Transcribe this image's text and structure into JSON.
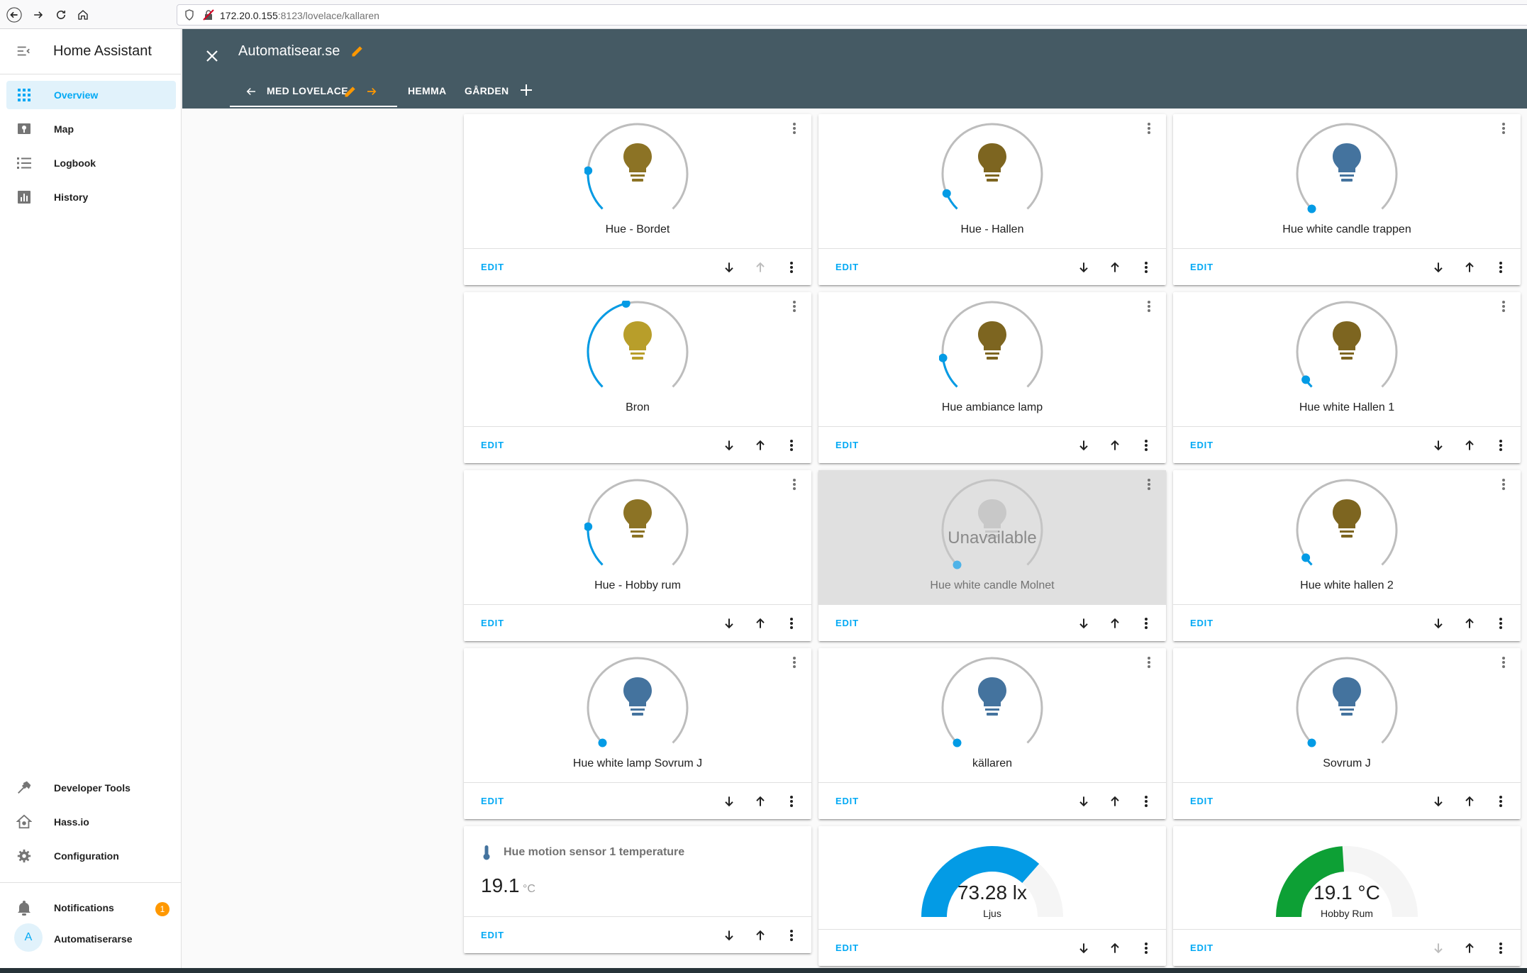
{
  "browser": {
    "url_host": "172.20.0.155",
    "url_rest": ":8123/lovelace/kallaren"
  },
  "sidebar": {
    "title": "Home Assistant",
    "items": [
      {
        "label": "Overview",
        "icon": "grid-icon",
        "active": true
      },
      {
        "label": "Map",
        "icon": "map-icon"
      },
      {
        "label": "Logbook",
        "icon": "list-icon"
      },
      {
        "label": "History",
        "icon": "chart-icon"
      }
    ],
    "bottom_items": [
      {
        "label": "Developer Tools",
        "icon": "hammer-icon"
      },
      {
        "label": "Hass.io",
        "icon": "hassio-icon"
      },
      {
        "label": "Configuration",
        "icon": "gear-icon"
      }
    ],
    "notifications": {
      "label": "Notifications",
      "count": "1"
    },
    "user": {
      "initial": "A",
      "name": "Automatiserarse"
    }
  },
  "header": {
    "title": "Automatisear.se",
    "tabs": [
      {
        "label": "MED LOVELACE",
        "active": true
      },
      {
        "label": "HEMMA"
      },
      {
        "label": "GÅRDEN"
      }
    ]
  },
  "card_actions": {
    "edit_label": "EDIT"
  },
  "lights": [
    {
      "name": "Hue - Bordet",
      "brightness": 0.18,
      "bulb_color": "#8c7325",
      "up_disabled": true
    },
    {
      "name": "Hue - Hallen",
      "brightness": 0.08,
      "bulb_color": "#7d6520"
    },
    {
      "name": "Hue white candle trappen",
      "brightness": 0.0,
      "bulb_color": "#44739e"
    },
    {
      "name": "Bron",
      "brightness": 0.45,
      "bulb_color": "#b89e2a"
    },
    {
      "name": "Hue ambiance lamp",
      "brightness": 0.14,
      "bulb_color": "#7d6520"
    },
    {
      "name": "Hue white Hallen 1",
      "brightness": 0.04,
      "bulb_color": "#7d6520"
    },
    {
      "name": "Hue - Hobby rum",
      "brightness": 0.18,
      "bulb_color": "#8c7325"
    },
    {
      "name": "Hue white candle Molnet",
      "brightness": 0.0,
      "bulb_color": "#c8c8c8",
      "unavailable": true,
      "unavailable_label": "Unavailable"
    },
    {
      "name": "Hue white hallen 2",
      "brightness": 0.04,
      "bulb_color": "#7d6520"
    },
    {
      "name": "Hue white lamp Sovrum J",
      "brightness": 0.0,
      "bulb_color": "#44739e"
    },
    {
      "name": "källaren",
      "brightness": 0.0,
      "bulb_color": "#44739e"
    },
    {
      "name": "Sovrum J",
      "brightness": 0.0,
      "bulb_color": "#44739e"
    }
  ],
  "sensor": {
    "title": "Hue motion sensor 1 temperature",
    "value": "19.1",
    "unit": "°C"
  },
  "gauges": [
    {
      "value_text": "73.28 lx",
      "name": "Ljus",
      "fraction": 0.73,
      "color": "#039be5"
    },
    {
      "value_text": "19.1 °C",
      "name": "Hobby Rum",
      "fraction": 0.48,
      "color": "#0da035",
      "down_disabled": true
    }
  ],
  "colors": {
    "accent": "#03a9f4",
    "header": "#455a64",
    "badge": "#ff9800"
  }
}
